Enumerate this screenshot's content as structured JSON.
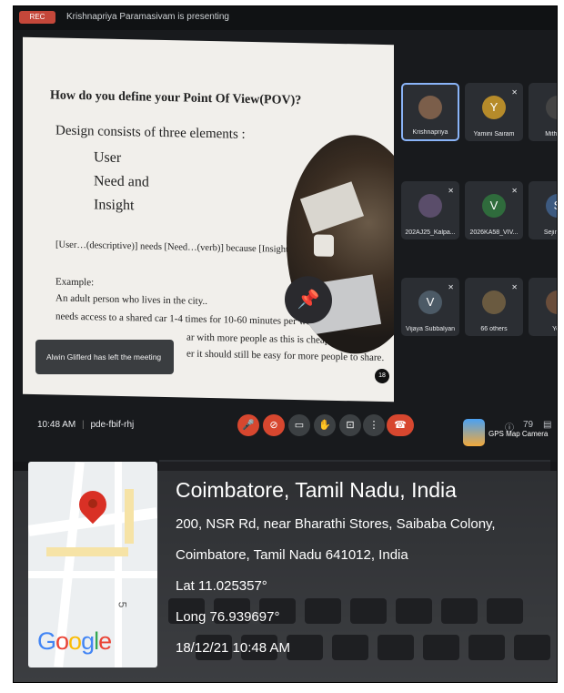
{
  "meeting": {
    "rec_label": "REC",
    "presenter_text": "Krishnapriya Paramasivam is presenting",
    "time": "10:48 AM",
    "divider": "|",
    "meeting_code": "pde-fbif-rhj"
  },
  "slide": {
    "question": "How do you define your Point Of View(POV)?",
    "design_heading": "Design consists of three elements :",
    "elements": [
      "User",
      "Need and",
      "Insight"
    ],
    "pov_template": "[User…(descriptive)] needs [Need…(verb)] because [Insight…(compelling)]",
    "example_label": "Example:",
    "example_lines": [
      "An adult person who lives in the city..",
      "needs access to a shared car 1-4 times for 10-60 minutes per week.",
      "ar with more people as this is cheaper, more",
      "er it should still be easy for more people to share."
    ],
    "page_number": "18"
  },
  "toast": {
    "text": "Alwin Gliflerd has left the meeting"
  },
  "participants": [
    {
      "name": "Krishnapriya",
      "initial": "",
      "color": "#7b5e4a",
      "active": true
    },
    {
      "name": "Yamini Sairam",
      "initial": "Y",
      "color": "#b68b2a",
      "active": false
    },
    {
      "name": "Mithun V",
      "initial": "",
      "color": "#444",
      "active": false
    },
    {
      "name": "202AJ25_Kalpa...",
      "initial": "",
      "color": "#5a4d6a",
      "active": false
    },
    {
      "name": "2026KA58_VIV...",
      "initial": "V",
      "color": "#2f6b3c",
      "active": false
    },
    {
      "name": "Sejin sing",
      "initial": "S",
      "color": "#3d5a80",
      "active": false
    },
    {
      "name": "Vijaya Subbalyan",
      "initial": "V",
      "color": "#4c5a66",
      "active": false
    },
    {
      "name": "66 others",
      "initial": "",
      "color": "#6a5a40",
      "active": false
    },
    {
      "name": "You",
      "initial": "",
      "color": "#6a4d3a",
      "active": false
    }
  ],
  "controls": {
    "mic": "🎤",
    "cam": "⊘",
    "captions": "▭",
    "hand": "✋",
    "present": "⊡",
    "more": "⋮",
    "end": "☎"
  },
  "right_tools": {
    "info": "ⓘ",
    "people": "79",
    "chat": "▤"
  },
  "gps_camera": {
    "label": "GPS Map Camera"
  },
  "location": {
    "title": "Coimbatore, Tamil Nadu, India",
    "line1": "200, NSR Rd, near Bharathi Stores, Saibaba Colony,",
    "line2": "Coimbatore, Tamil Nadu 641012, India",
    "lat": "Lat 11.025357°",
    "long": "Long 76.939697°",
    "datetime": "18/12/21 10:48 AM"
  },
  "map": {
    "google": [
      "G",
      "o",
      "o",
      "g",
      "l",
      "e"
    ],
    "road_number": "5"
  }
}
